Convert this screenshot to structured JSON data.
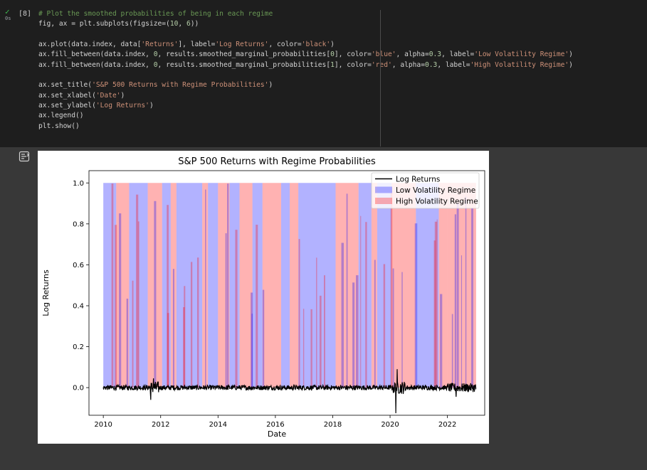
{
  "cell": {
    "exec_count": "[8]",
    "run_check": "✓",
    "run_time": "0s",
    "code_lines": [
      "# Plot the smoothed probabilities of being in each regime",
      "fig, ax = plt.subplots(figsize=(10, 6))",
      "",
      "ax.plot(data.index, data['Returns'], label='Log Returns', color='black')",
      "ax.fill_between(data.index, 0, results.smoothed_marginal_probabilities[0], color='blue', alpha=0.3, label='Low Volatility Regime')",
      "ax.fill_between(data.index, 0, results.smoothed_marginal_probabilities[1], color='red', alpha=0.3, label='High Volatility Regime')",
      "",
      "ax.set_title('S&P 500 Returns with Regime Probabilities')",
      "ax.set_xlabel('Date')",
      "ax.set_ylabel('Log Returns')",
      "ax.legend()",
      "plt.show()"
    ]
  },
  "output": {
    "icon": "output-toggle-icon"
  },
  "chart_data": {
    "type": "area",
    "title": "S&P 500 Returns with Regime Probabilities",
    "xlabel": "Date",
    "ylabel": "Log Returns",
    "x_ticks": [
      "2010",
      "2012",
      "2014",
      "2016",
      "2018",
      "2020",
      "2022"
    ],
    "y_ticks": [
      "0.0",
      "0.2",
      "0.4",
      "0.6",
      "0.8",
      "1.0"
    ],
    "xlim": [
      2009.5,
      2023.3
    ],
    "ylim": [
      -0.135,
      1.06
    ],
    "grid": false,
    "legend_position": "top-right",
    "legend": [
      {
        "label": "Log Returns",
        "kind": "line",
        "color": "#000000"
      },
      {
        "label": "Low Volatility Regime",
        "kind": "patch",
        "color": "#0000ff",
        "alpha": 0.3
      },
      {
        "label": "High Volatility Regime",
        "kind": "patch",
        "color": "#ff0000",
        "alpha": 0.3
      }
    ],
    "regimes": [
      {
        "start": 2010.0,
        "end": 2010.45,
        "regime": "low"
      },
      {
        "start": 2010.45,
        "end": 2010.9,
        "regime": "high"
      },
      {
        "start": 2010.9,
        "end": 2011.55,
        "regime": "low"
      },
      {
        "start": 2011.55,
        "end": 2012.05,
        "regime": "high"
      },
      {
        "start": 2012.05,
        "end": 2012.35,
        "regime": "low"
      },
      {
        "start": 2012.35,
        "end": 2012.55,
        "regime": "high"
      },
      {
        "start": 2012.55,
        "end": 2013.45,
        "regime": "low"
      },
      {
        "start": 2013.45,
        "end": 2013.65,
        "regime": "high"
      },
      {
        "start": 2013.65,
        "end": 2014.0,
        "regime": "low"
      },
      {
        "start": 2014.0,
        "end": 2014.4,
        "regime": "high"
      },
      {
        "start": 2014.4,
        "end": 2014.75,
        "regime": "low"
      },
      {
        "start": 2014.75,
        "end": 2015.2,
        "regime": "high"
      },
      {
        "start": 2015.2,
        "end": 2015.55,
        "regime": "low"
      },
      {
        "start": 2015.55,
        "end": 2016.2,
        "regime": "high"
      },
      {
        "start": 2016.2,
        "end": 2016.5,
        "regime": "low"
      },
      {
        "start": 2016.5,
        "end": 2016.8,
        "regime": "high"
      },
      {
        "start": 2016.8,
        "end": 2018.1,
        "regime": "low"
      },
      {
        "start": 2018.1,
        "end": 2018.9,
        "regime": "high"
      },
      {
        "start": 2018.9,
        "end": 2019.35,
        "regime": "low"
      },
      {
        "start": 2019.35,
        "end": 2019.55,
        "regime": "high"
      },
      {
        "start": 2019.55,
        "end": 2020.05,
        "regime": "low"
      },
      {
        "start": 2020.05,
        "end": 2020.9,
        "regime": "high"
      },
      {
        "start": 2020.9,
        "end": 2021.7,
        "regime": "low"
      },
      {
        "start": 2021.7,
        "end": 2022.0,
        "regime": "high"
      },
      {
        "start": 2022.0,
        "end": 2023.0,
        "regime": "high"
      }
    ],
    "returns": {
      "x_start": 2010.0,
      "x_end": 2023.0,
      "typical_abs": 0.012,
      "spikes": [
        {
          "x": 2011.65,
          "y": -0.06
        },
        {
          "x": 2011.75,
          "y": 0.045
        },
        {
          "x": 2020.2,
          "y": -0.125
        },
        {
          "x": 2020.25,
          "y": 0.09
        },
        {
          "x": 2022.3,
          "y": -0.045
        }
      ]
    }
  }
}
